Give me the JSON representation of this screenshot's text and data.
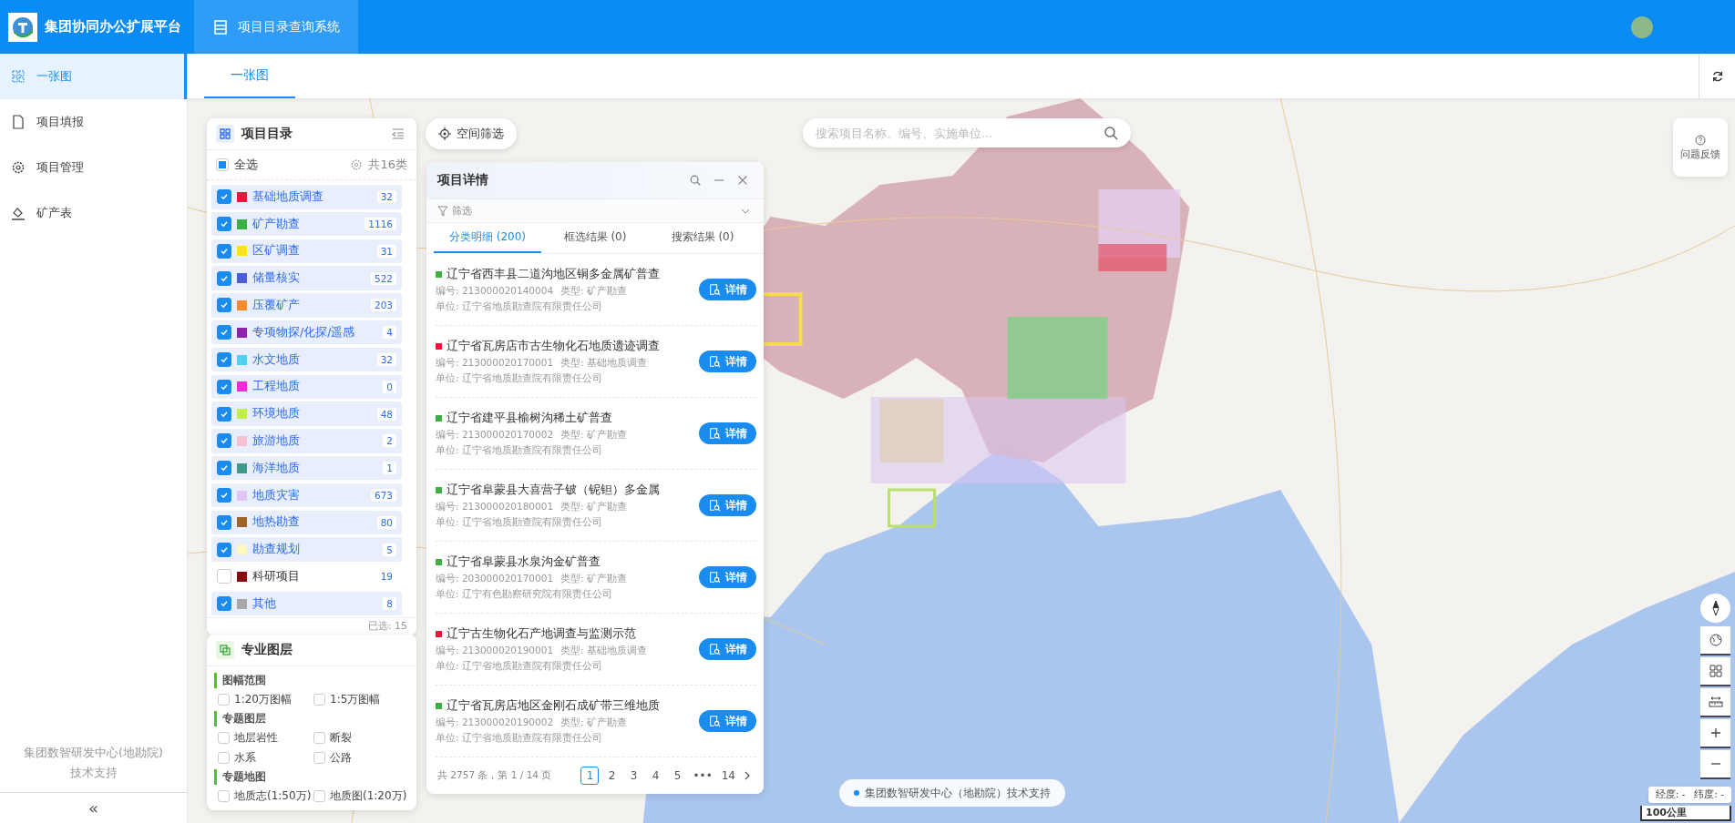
{
  "header": {
    "platform_title": "集团协同办公扩展平台",
    "system_tab": "项目目录查询系统"
  },
  "sidebar": {
    "items": [
      {
        "label": "一张图",
        "selected": true
      },
      {
        "label": "项目填报",
        "selected": false
      },
      {
        "label": "项目管理",
        "selected": false
      },
      {
        "label": "矿产表",
        "selected": false
      }
    ],
    "footer_lines": [
      "集团数智研发中心(地勘院)",
      "技术支持"
    ],
    "collapse": "«"
  },
  "tabs": [
    {
      "label": "一张图",
      "selected": true
    }
  ],
  "catalog": {
    "title": "项目目录",
    "select_all": {
      "label": "全选",
      "indeterminate": true
    },
    "total": "共16类",
    "categories": [
      {
        "name": "基础地质调查",
        "color": "#e8173c",
        "count": "32",
        "checked": true
      },
      {
        "name": "矿产勘查",
        "color": "#3cb043",
        "count": "1116",
        "checked": true
      },
      {
        "name": "区矿调查",
        "color": "#ffe21a",
        "count": "31",
        "checked": true
      },
      {
        "name": "储量核实",
        "color": "#4a5fd6",
        "count": "522",
        "checked": true
      },
      {
        "name": "压覆矿产",
        "color": "#f58a2e",
        "count": "203",
        "checked": true
      },
      {
        "name": "专项物探/化探/遥感",
        "color": "#8e24aa",
        "count": "4",
        "checked": true
      },
      {
        "name": "水文地质",
        "color": "#4dd2f0",
        "count": "32",
        "checked": true
      },
      {
        "name": "工程地质",
        "color": "#f02ad8",
        "count": "0",
        "checked": true
      },
      {
        "name": "环境地质",
        "color": "#bff04a",
        "count": "48",
        "checked": true
      },
      {
        "name": "旅游地质",
        "color": "#f8c0d0",
        "count": "2",
        "checked": true
      },
      {
        "name": "海洋地质",
        "color": "#3f9a8a",
        "count": "1",
        "checked": true
      },
      {
        "name": "地质灾害",
        "color": "#e0c4f5",
        "count": "673",
        "checked": true
      },
      {
        "name": "地热勘查",
        "color": "#a0642a",
        "count": "80",
        "checked": true
      },
      {
        "name": "勘查规划",
        "color": "#fff6c0",
        "count": "5",
        "checked": true
      },
      {
        "name": "科研项目",
        "color": "#8a0b0b",
        "count": "19",
        "checked": false
      },
      {
        "name": "其他",
        "color": "#a8a8a8",
        "count": "8",
        "checked": true
      }
    ],
    "selected_count": "已选: 15"
  },
  "layers": {
    "title": "专业图层",
    "groups": [
      {
        "title": "图幅范围",
        "options": [
          {
            "label": "1:20万图幅",
            "checked": false
          },
          {
            "label": "1:5万图幅",
            "checked": false
          }
        ]
      },
      {
        "title": "专题图层",
        "options": [
          {
            "label": "地层岩性",
            "checked": false
          },
          {
            "label": "断裂",
            "checked": false
          },
          {
            "label": "水系",
            "checked": false
          },
          {
            "label": "公路",
            "checked": false
          }
        ]
      },
      {
        "title": "专题地图",
        "options": [
          {
            "label": "地质志(1:50万)",
            "checked": false
          },
          {
            "label": "地质图(1:20万)",
            "checked": false
          }
        ]
      }
    ]
  },
  "space_filter": "空间筛选",
  "search": {
    "placeholder": "搜索项目名称、编号、实施单位..."
  },
  "details": {
    "title": "项目详情",
    "filter": "筛选",
    "tabs": [
      {
        "label": "分类明细 (200)",
        "selected": true
      },
      {
        "label": "框选结果 (0)",
        "selected": false
      },
      {
        "label": "搜索结果 (0)",
        "selected": false
      }
    ],
    "items": [
      {
        "title": "辽宁省西丰县二道沟地区铜多金属矿普查",
        "color": "#3cb043",
        "code": "编号: 213000020140004",
        "type": "类型: 矿产勘查",
        "unit": "单位: 辽宁省地质勘查院有限责任公司",
        "button": "详情"
      },
      {
        "title": "辽宁省瓦房店市古生物化石地质遗迹调查",
        "color": "#e8173c",
        "code": "编号: 213000020170001",
        "type": "类型: 基础地质调查",
        "unit": "单位: 辽宁省地质勘查院有限责任公司",
        "button": "详情"
      },
      {
        "title": "辽宁省建平县榆树沟稀土矿普查",
        "color": "#3cb043",
        "code": "编号: 213000020170002",
        "type": "类型: 矿产勘查",
        "unit": "单位: 辽宁省地质勘查院有限责任公司",
        "button": "详情"
      },
      {
        "title": "辽宁省阜蒙县大喜营子铍（铌钽）多金属",
        "color": "#3cb043",
        "code": "编号: 213000020180001",
        "type": "类型: 矿产勘查",
        "unit": "单位: 辽宁省地质勘查院有限责任公司",
        "button": "详情"
      },
      {
        "title": "辽宁省阜蒙县水泉沟金矿普查",
        "color": "#3cb043",
        "code": "编号: 203000020170001",
        "type": "类型: 矿产勘查",
        "unit": "单位: 辽宁有色勘察研究院有限责任公司",
        "button": "详情"
      },
      {
        "title": "辽宁古生物化石产地调查与监测示范",
        "color": "#e8173c",
        "code": "编号: 213000020190001",
        "type": "类型: 基础地质调查",
        "unit": "单位: 辽宁省地质勘查院有限责任公司",
        "button": "详情"
      },
      {
        "title": "辽宁省瓦房店地区金刚石成矿带三维地质",
        "color": "#3cb043",
        "code": "编号: 213000020190002",
        "type": "类型: 矿产勘查",
        "unit": "单位: 辽宁省地质勘查院有限责任公司",
        "button": "详情"
      }
    ],
    "pagination": {
      "summary": "共 2757 条，第 1 / 14 页",
      "pages": [
        {
          "label": "1",
          "selected": true
        },
        {
          "label": "2",
          "selected": false
        },
        {
          "label": "3",
          "selected": false
        },
        {
          "label": "4",
          "selected": false
        },
        {
          "label": "5",
          "selected": false
        },
        {
          "label": "•••",
          "selected": false
        },
        {
          "label": "14",
          "selected": false
        }
      ]
    }
  },
  "feedback": "问题反馈",
  "coordinates": {
    "longitude": "经度: -",
    "latitude": "纬度: -"
  },
  "scale": "100公里",
  "support_badge": "集团数智研发中心（地勘院）技术支持"
}
